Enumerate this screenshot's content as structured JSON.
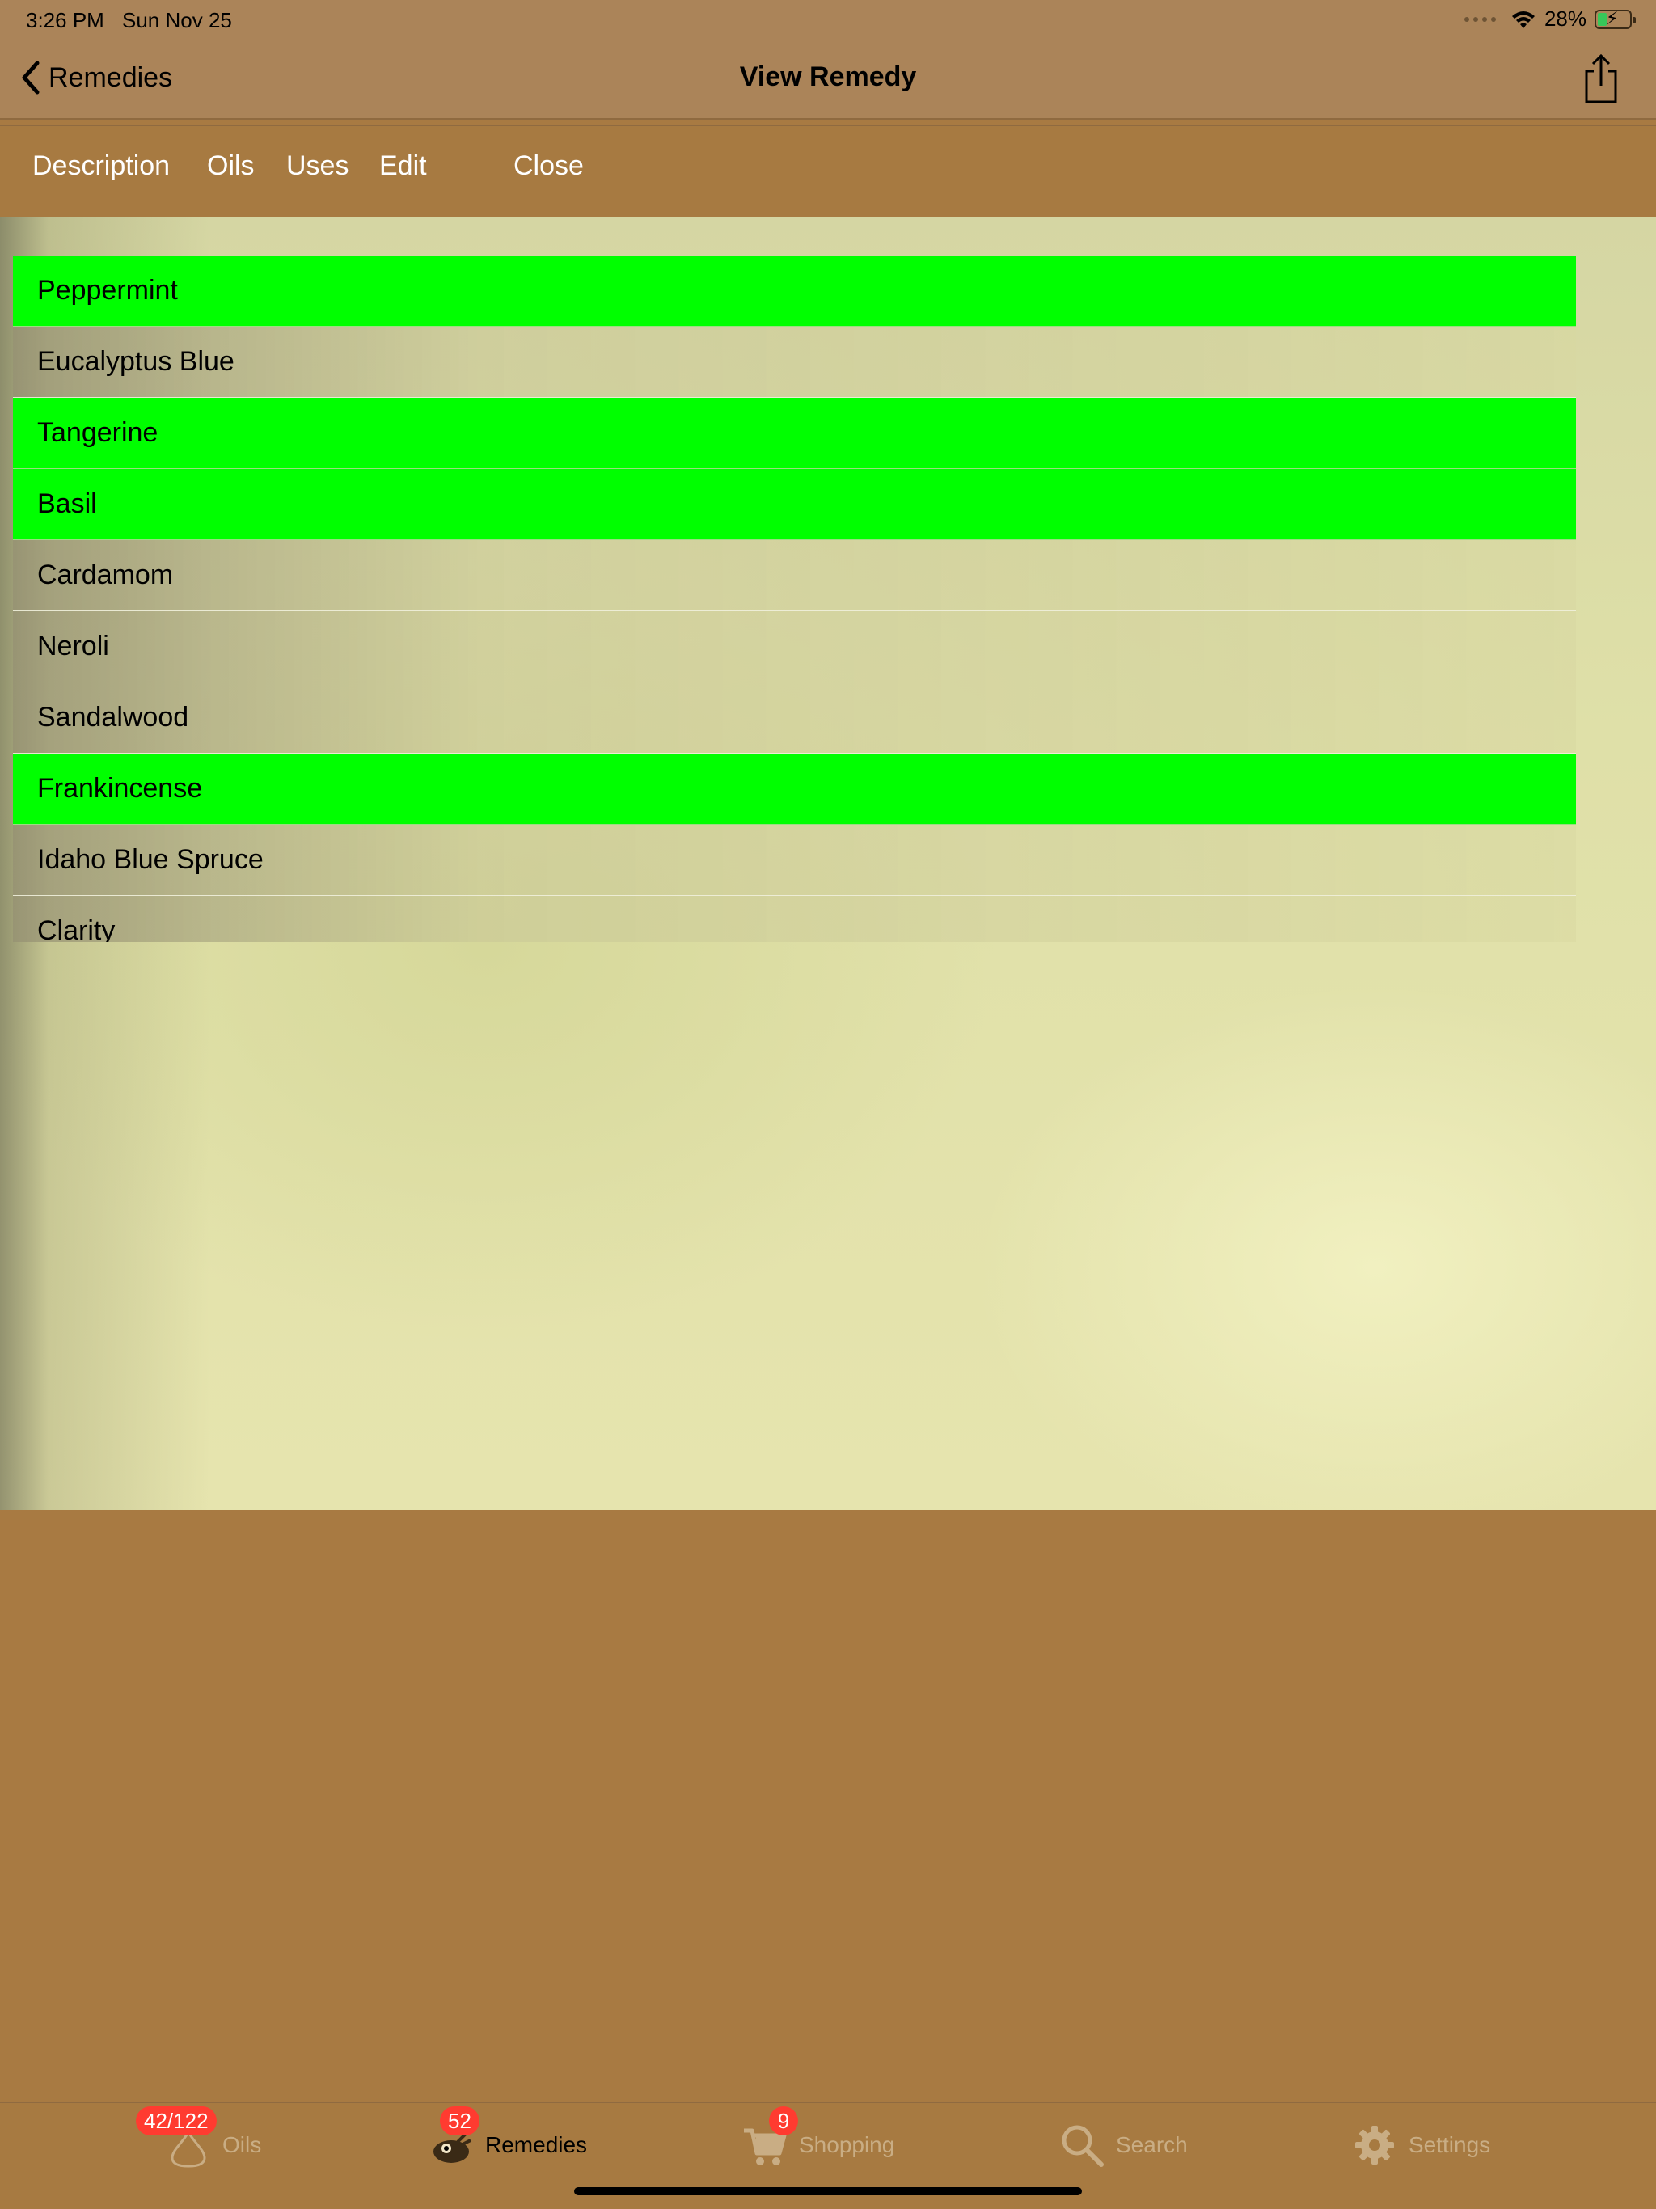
{
  "status_bar": {
    "time": "3:26 PM",
    "date": "Sun Nov 25",
    "battery": "28%",
    "battery_level": 0.28,
    "icons": [
      "signal-dots-icon",
      "wifi-icon",
      "battery-charging-icon"
    ]
  },
  "nav": {
    "back_label": "Remedies",
    "title": "View Remedy",
    "share_icon": "share-icon"
  },
  "segments": [
    "Description",
    "Oils",
    "Uses",
    "Edit",
    "Close"
  ],
  "colors": {
    "chrome": "#a77a41",
    "selected_row": "#00ff00",
    "badge": "#ff3b30"
  },
  "oils": [
    {
      "name": "Peppermint",
      "selected": true
    },
    {
      "name": "Eucalyptus Blue",
      "selected": false
    },
    {
      "name": "Tangerine",
      "selected": true
    },
    {
      "name": "Basil",
      "selected": true
    },
    {
      "name": "Cardamom",
      "selected": false
    },
    {
      "name": "Neroli",
      "selected": false
    },
    {
      "name": "Sandalwood",
      "selected": false
    },
    {
      "name": "Frankincense",
      "selected": true
    },
    {
      "name": "Idaho Blue Spruce",
      "selected": false
    },
    {
      "name": "Clarity",
      "selected": false
    }
  ],
  "tabs": [
    {
      "label": "Oils",
      "badge": "42/122",
      "icon": "drop-icon",
      "active": false
    },
    {
      "label": "Remedies",
      "badge": "52",
      "icon": "remedies-icon",
      "active": true
    },
    {
      "label": "Shopping",
      "badge": "9",
      "icon": "cart-icon",
      "active": false
    },
    {
      "label": "Search",
      "badge": null,
      "icon": "search-icon",
      "active": false
    },
    {
      "label": "Settings",
      "badge": null,
      "icon": "gear-icon",
      "active": false
    }
  ]
}
